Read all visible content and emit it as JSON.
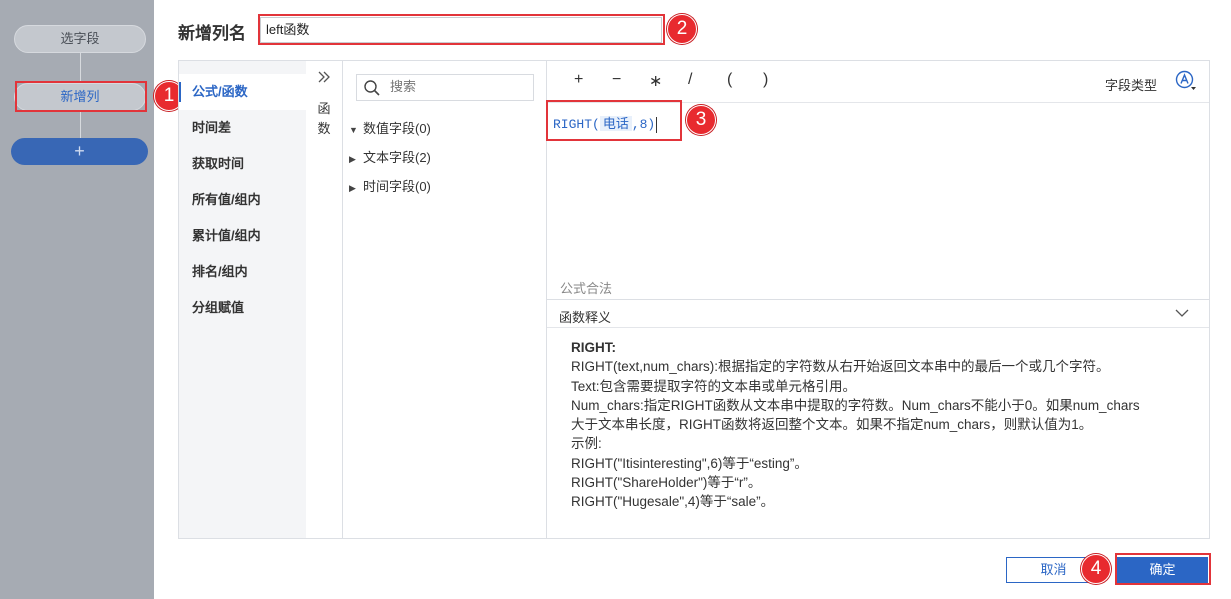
{
  "left_nav": {
    "select_fields_label": "选字段",
    "new_column_label": "新增列",
    "add_label": "+"
  },
  "header": {
    "title_label": "新增列名",
    "name_value": "left函数"
  },
  "categories": [
    {
      "label": "公式/函数",
      "active": true
    },
    {
      "label": "时间差",
      "active": false
    },
    {
      "label": "获取时间",
      "active": false
    },
    {
      "label": "所有值/组内",
      "active": false
    },
    {
      "label": "累计值/组内",
      "active": false
    },
    {
      "label": "排名/组内",
      "active": false
    },
    {
      "label": "分组赋值",
      "active": false
    }
  ],
  "function_panel": {
    "expand_icon": "double-chevron-right-icon",
    "label_top": "函",
    "label_bottom": "数"
  },
  "field_tree": {
    "search_placeholder": "搜索",
    "nodes": [
      {
        "label": "数值字段(0)",
        "expanded": true
      },
      {
        "label": "文本字段(2)",
        "expanded": false
      },
      {
        "label": "时间字段(0)",
        "expanded": false
      }
    ]
  },
  "toolbar": {
    "operators": [
      "+",
      "−",
      "∗",
      "/",
      "(",
      ")"
    ],
    "field_type_label": "字段类型"
  },
  "formula": {
    "prefix": "RIGHT(",
    "field_token": "电话",
    "suffix": ",8)",
    "validity_text": "公式合法"
  },
  "explanation": {
    "header": "函数释义",
    "fn_name": "RIGHT:",
    "lines": [
      "RIGHT(text,num_chars):根据指定的字符数从右开始返回文本串中的最后一个或几个字符。",
      "Text:包含需要提取字符的文本串或单元格引用。",
      "Num_chars:指定RIGHT函数从文本串中提取的字符数。Num_chars不能小于0。如果num_chars",
      "大于文本串长度，RIGHT函数将返回整个文本。如果不指定num_chars，则默认值为1。",
      "示例:",
      "RIGHT(\"Itisinteresting\",6)等于“esting”。",
      "RIGHT(\"ShareHolder\")等于“r”。",
      "RIGHT(\"Hugesale\",4)等于“sale”。"
    ]
  },
  "footer": {
    "cancel_label": "取消",
    "ok_label": "确定"
  },
  "annotations": {
    "badge_1": "1",
    "badge_2": "2",
    "badge_3": "3",
    "badge_4": "4"
  },
  "colors": {
    "accent": "#2b66c5",
    "highlight_border": "#e2343a",
    "left_panel_bg": "#a6abb3",
    "category_bg": "#f4f5f7"
  }
}
